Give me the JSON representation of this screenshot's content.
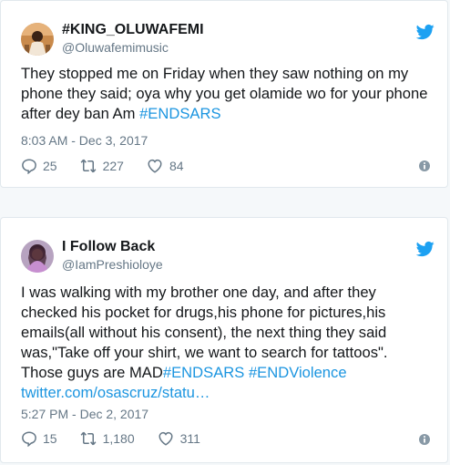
{
  "tweets": [
    {
      "display_name": "#KING_OLUWAFEMI",
      "handle": "@Oluwafemimusic",
      "text_plain": "They stopped me on Friday when they saw nothing on my phone they said; oya why you get olamide wo for your phone after dey ban Am ",
      "hashtags": [
        "#ENDSARS"
      ],
      "timestamp": "8:03 AM - Dec 3, 2017",
      "replies": "25",
      "retweets": "227",
      "likes": "84"
    },
    {
      "display_name": "I Follow Back",
      "handle": "@IamPreshioloye",
      "text_plain": "I was walking with my brother one day, and after they checked his pocket for drugs,his phone for pictures,his emails(all without his consent), the next thing they said was,\"Take off your shirt, we want to search for tattoos\". Those guys are MAD",
      "hashtags": [
        "#ENDSARS",
        "#ENDViolence"
      ],
      "link": "twitter.com/osascruz/statu…",
      "timestamp": "5:27 PM - Dec 2, 2017",
      "replies": "15",
      "retweets": "1,180",
      "likes": "311"
    }
  ],
  "colors": {
    "link": "#1b95e0",
    "secondary_text": "#657786",
    "primary_text": "#14171a",
    "border": "#e1e8ed",
    "twitter_blue": "#1da1f2"
  },
  "icons": [
    "twitter-bird-icon",
    "reply-icon",
    "retweet-icon",
    "like-icon",
    "info-icon"
  ]
}
